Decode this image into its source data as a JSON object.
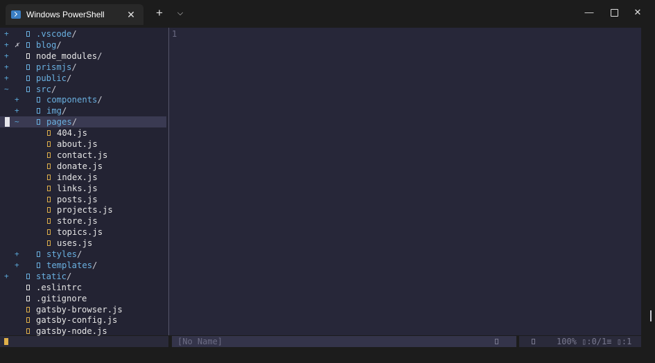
{
  "window": {
    "tab_title": "Windows PowerShell",
    "tab_close": "✕",
    "new_tab": "+",
    "dropdown": "⌵",
    "minimize": "—",
    "close": "✕"
  },
  "tree": {
    "rows": [
      {
        "mark": "+",
        "depth": 0,
        "kind": "dir",
        "name": "vscode",
        "label": ".vscode",
        "slash": "/"
      },
      {
        "mark": "+",
        "xmark": "✗",
        "depth": 0,
        "kind": "dir",
        "label": "blog",
        "slash": "/"
      },
      {
        "mark": "+",
        "depth": 0,
        "kind": "plain",
        "label": "node_modules",
        "slash": "/"
      },
      {
        "mark": "+",
        "depth": 0,
        "kind": "dir",
        "label": "prismjs",
        "slash": "/"
      },
      {
        "mark": "+",
        "depth": 0,
        "kind": "dir",
        "label": "public",
        "slash": "/"
      },
      {
        "mark": "~",
        "depth": 0,
        "kind": "dir",
        "label": "src",
        "slash": "/"
      },
      {
        "mark": "+",
        "depth": 1,
        "kind": "dir",
        "label": "components",
        "slash": "/"
      },
      {
        "mark": "+",
        "depth": 1,
        "kind": "dir",
        "label": "img",
        "slash": "/"
      },
      {
        "mark": "~",
        "depth": 1,
        "kind": "dir",
        "label": "pages",
        "slash": "/",
        "selected": true
      },
      {
        "depth": 2,
        "kind": "js",
        "label": "404.js"
      },
      {
        "depth": 2,
        "kind": "js",
        "label": "about.js"
      },
      {
        "depth": 2,
        "kind": "js",
        "label": "contact.js"
      },
      {
        "depth": 2,
        "kind": "js",
        "label": "donate.js"
      },
      {
        "depth": 2,
        "kind": "js",
        "label": "index.js"
      },
      {
        "depth": 2,
        "kind": "js",
        "label": "links.js"
      },
      {
        "depth": 2,
        "kind": "js",
        "label": "posts.js"
      },
      {
        "depth": 2,
        "kind": "js",
        "label": "projects.js"
      },
      {
        "depth": 2,
        "kind": "js",
        "label": "store.js"
      },
      {
        "depth": 2,
        "kind": "js",
        "label": "topics.js"
      },
      {
        "depth": 2,
        "kind": "js",
        "label": "uses.js"
      },
      {
        "mark": "+",
        "depth": 1,
        "kind": "dir",
        "label": "styles",
        "slash": "/"
      },
      {
        "mark": "+",
        "depth": 1,
        "kind": "dir",
        "label": "templates",
        "slash": "/"
      },
      {
        "mark": "+",
        "depth": 0,
        "kind": "dir",
        "label": "static",
        "slash": "/"
      },
      {
        "depth": 0,
        "kind": "plain",
        "label": ".eslintrc"
      },
      {
        "depth": 0,
        "kind": "plain",
        "label": ".gitignore"
      },
      {
        "depth": 0,
        "kind": "js",
        "label": "gatsby-browser.js"
      },
      {
        "depth": 0,
        "kind": "js",
        "label": "gatsby-config.js"
      },
      {
        "depth": 0,
        "kind": "js",
        "label": "gatsby-node.js"
      }
    ]
  },
  "editor": {
    "line_number": "1"
  },
  "status": {
    "buffer_name": "[No Name]",
    "position": "100% ▯:0/1≡ ▯:1"
  },
  "colors": {
    "directory": "#6ab0e0",
    "js_file": "#e0b04a",
    "plain_file": "#e6e6e6",
    "tree_bg": "#232333",
    "editor_bg": "#272739"
  }
}
